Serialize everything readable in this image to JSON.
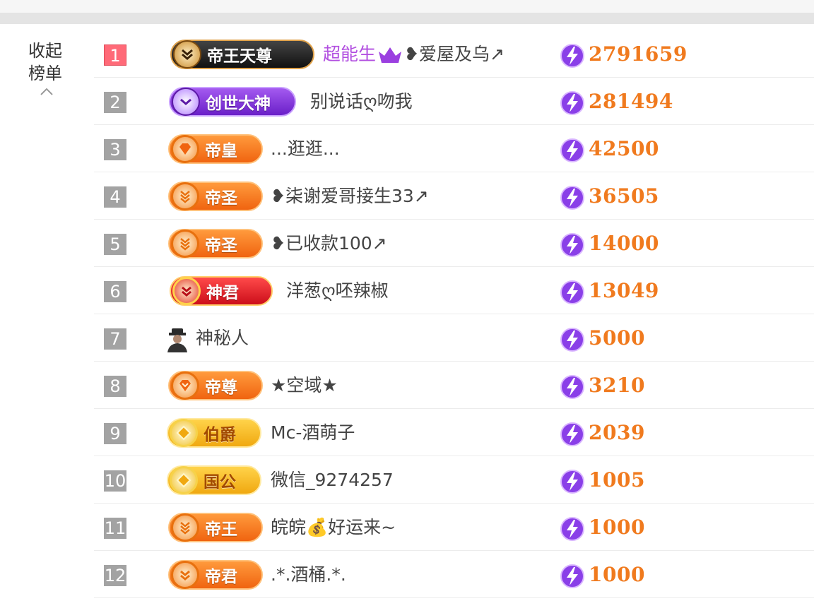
{
  "sidebar": {
    "collapse_label": "收起榜单"
  },
  "colors": {
    "score": "#f07a1e",
    "rank_first": "#ff6a78",
    "rank_default": "#a3a3a3",
    "highlight_name": "#b24fe0"
  },
  "rows": [
    {
      "rank": "1",
      "badge": "帝王天尊",
      "name": "超能生",
      "name_suffix": "❥爱屋及乌↗",
      "score": "2791659"
    },
    {
      "rank": "2",
      "badge": "创世大神",
      "name": "别说话ღ吻我",
      "score": "281494"
    },
    {
      "rank": "3",
      "badge": "帝皇",
      "name": "...逛逛...",
      "score": "42500"
    },
    {
      "rank": "4",
      "badge": "帝圣",
      "name": "❥柒谢爱哥接生33↗",
      "score": "36505"
    },
    {
      "rank": "5",
      "badge": "帝圣",
      "name": "❥已收款100↗",
      "score": "14000"
    },
    {
      "rank": "6",
      "badge": "神君",
      "name": "洋葱ღ呸辣椒",
      "score": "13049"
    },
    {
      "rank": "7",
      "badge": "",
      "name": "神秘人",
      "score": "5000"
    },
    {
      "rank": "8",
      "badge": "帝尊",
      "name": "★空域★",
      "score": "3210"
    },
    {
      "rank": "9",
      "badge": "伯爵",
      "name": "Mc-酒萌子",
      "score": "2039"
    },
    {
      "rank": "10",
      "badge": "国公",
      "name": "微信_9274257",
      "score": "1005"
    },
    {
      "rank": "11",
      "badge": "帝王",
      "name": "皖皖💰好运来~",
      "score": "1000"
    },
    {
      "rank": "12",
      "badge": "帝君",
      "name": ".*.酒桶.*.",
      "score": "1000"
    }
  ]
}
